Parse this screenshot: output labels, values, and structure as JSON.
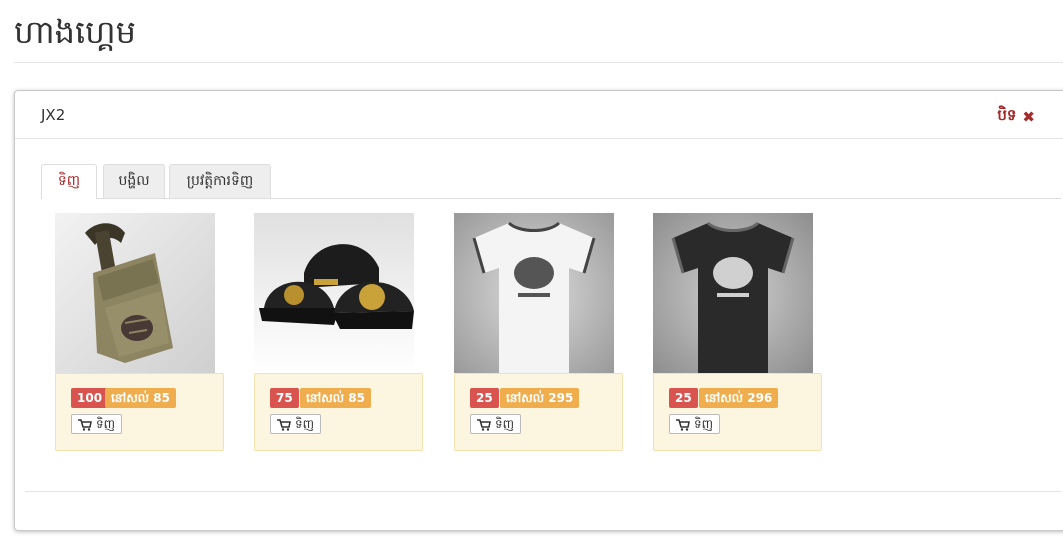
{
  "page": {
    "title": "ហាងហ្គេម"
  },
  "panel": {
    "title": "JX2",
    "close_label": "បិទ",
    "close_icon": "close-icon"
  },
  "tabs": [
    {
      "label": "ទិញ",
      "active": true
    },
    {
      "label": "បង្ហិល",
      "active": false
    },
    {
      "label": "ប្រវត្តិការទិញ",
      "active": false
    }
  ],
  "products": [
    {
      "image": "backpack",
      "price": "100",
      "stock": "នៅសល់ 85",
      "buy_label": "ទិញ"
    },
    {
      "image": "caps",
      "price": "75",
      "stock": "នៅសល់ 85",
      "buy_label": "ទិញ"
    },
    {
      "image": "white-tshirt",
      "price": "25",
      "stock": "នៅសល់ 295",
      "buy_label": "ទិញ"
    },
    {
      "image": "black-tshirt",
      "price": "25",
      "stock": "នៅសល់ 296",
      "buy_label": "ទិញ"
    }
  ],
  "colors": {
    "accent": "#a52a2a",
    "price_badge": "#d9534f",
    "stock_badge": "#f0ad4e",
    "card_bg": "#fcf5df"
  }
}
